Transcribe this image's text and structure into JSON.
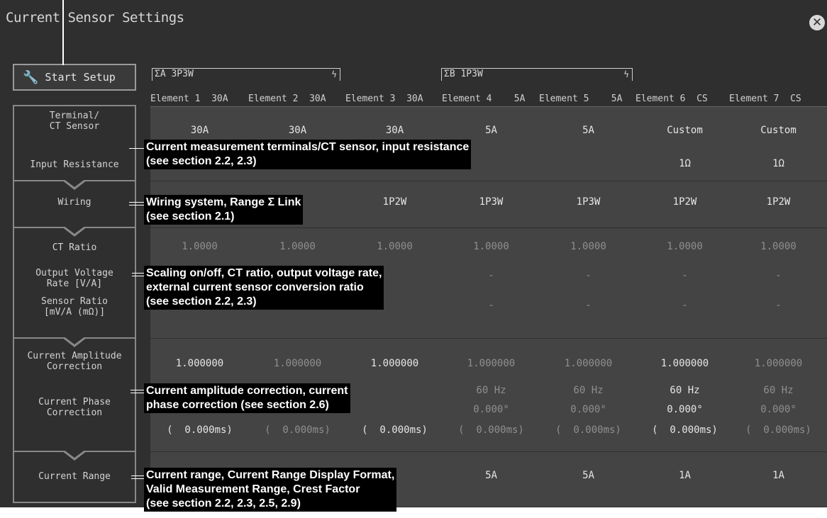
{
  "title": "Current Sensor Settings",
  "close_icon": "close-icon",
  "start_setup": {
    "label": "Start Setup",
    "icon": "wrench-icon"
  },
  "side": {
    "terminal": "Terminal/\nCT Sensor",
    "input_resistance": "Input Resistance",
    "wiring": "Wiring",
    "ct_ratio": "CT Ratio",
    "output_voltage": "Output Voltage\nRate [V/A]",
    "sensor_ratio": "Sensor Ratio\n[mV/A (mΩ)]",
    "amp_corr": "Current Amplitude\nCorrection",
    "phase_corr": "Current Phase\nCorrection",
    "range": "Current Range"
  },
  "groups": [
    {
      "label": "ΣA 3P3W",
      "link_icon": "ϟ"
    },
    {
      "label": "ΣB 1P3W",
      "link_icon": "ϟ"
    }
  ],
  "elements": [
    "Element 1  30A",
    "Element 2  30A",
    "Element 3  30A",
    "Element 4    5A",
    "Element 5    5A",
    "Element 6  CS",
    "Element 7  CS"
  ],
  "rows": {
    "terminal": [
      "30A",
      "30A",
      "30A",
      "5A",
      "5A",
      "Custom",
      "Custom"
    ],
    "input_resistance": [
      "",
      "",
      "",
      "",
      "",
      "1Ω",
      "1Ω"
    ],
    "wiring": [
      "",
      "",
      "1P2W",
      "1P3W",
      "1P3W",
      "1P2W",
      "1P2W"
    ],
    "ct_ratio": [
      "1.0000",
      "1.0000",
      "1.0000",
      "1.0000",
      "1.0000",
      "1.0000",
      "1.0000"
    ],
    "output_voltage": [
      "",
      "",
      "",
      "-",
      "-",
      "-",
      "-"
    ],
    "sensor_ratio": [
      "",
      "",
      "",
      "-",
      "-",
      "-",
      "-"
    ],
    "amp_corr": [
      "1.000000",
      "1.000000",
      "1.000000",
      "1.000000",
      "1.000000",
      "1.000000",
      "1.000000"
    ],
    "phase_freq": [
      "",
      "",
      "",
      "60 Hz",
      "60 Hz",
      "60 Hz",
      "60 Hz"
    ],
    "phase_deg": [
      "",
      "",
      "",
      "0.000°",
      "0.000°",
      "0.000°",
      "0.000°"
    ],
    "phase_ms": [
      "(  0.000ms)",
      "(  0.000ms)",
      "(  0.000ms)",
      "(  0.000ms)",
      "(  0.000ms)",
      "(  0.000ms)",
      "(  0.000ms)"
    ],
    "range": [
      "",
      "",
      "",
      "5A",
      "5A",
      "1A",
      "1A"
    ]
  },
  "annotations": {
    "terminal": "Current measurement terminals/CT sensor, input resistance\n(see section 2.2, 2.3)",
    "wiring": "Wiring system, Range Σ Link\n(see section 2.1)",
    "scaling": "Scaling on/off, CT ratio, output voltage rate,\nexternal current sensor conversion ratio\n(see section 2.2, 2.3)",
    "correction": "Current amplitude correction, current\nphase correction (see section 2.6)",
    "range": "Current range, Current Range Display Format,\nValid Measurement Range, Crest Factor\n(see section 2.2, 2.3, 2.5, 2.9)"
  },
  "colors": {
    "background": "#2f2f2f",
    "grid": "#444444",
    "text": "#e6e6e6",
    "dim": "#8f8f8f"
  }
}
